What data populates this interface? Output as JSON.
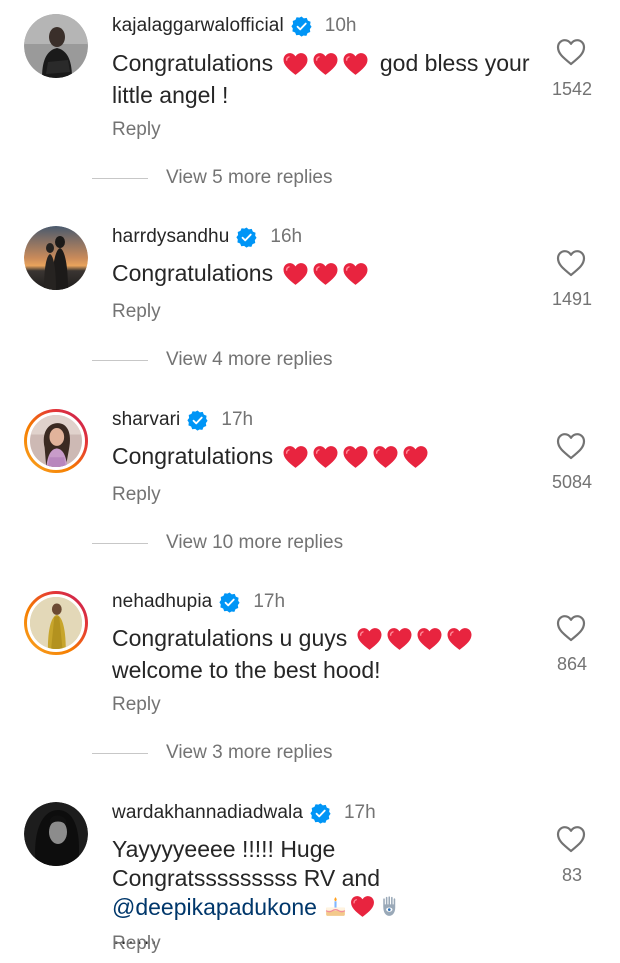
{
  "comments": [
    {
      "username": "kajalaggarwalofficial",
      "time": "10h",
      "text_a": "Congratulations",
      "text_b": "god bless your little angel !",
      "likes": "1542",
      "reply_label": "Reply",
      "view_replies": "View 5 more replies"
    },
    {
      "username": "harrdysandhu",
      "time": "16h",
      "text_a": "Congratulations",
      "likes": "1491",
      "reply_label": "Reply",
      "view_replies": "View 4 more replies"
    },
    {
      "username": "sharvari",
      "time": "17h",
      "text_a": "Congratulations",
      "likes": "5084",
      "reply_label": "Reply",
      "view_replies": "View 10 more replies"
    },
    {
      "username": "nehadhupia",
      "time": "17h",
      "text_a": "Congratulations u guys",
      "text_b": "welcome to the best hood!",
      "likes": "864",
      "reply_label": "Reply",
      "view_replies": "View 3 more replies"
    },
    {
      "username": "wardakhannadiadwala",
      "time": "17h",
      "text_a": "Yayyyyeeee !!!!! Huge Congratsssssssss RV and",
      "mention": "@deepikapadukone",
      "text_b": "……",
      "likes": "83",
      "reply_label": "Reply"
    }
  ],
  "icons": {
    "verified": "verified-badge-icon",
    "like": "heart-outline-icon",
    "heart_emoji": "red-heart-emoji",
    "cake_emoji": "birthday-cake-emoji",
    "hamsa_emoji": "hamsa-emoji"
  },
  "colors": {
    "verified_blue": "#0095f6",
    "heart_red": "#e8243f",
    "secondary_text": "#737373",
    "primary_text": "#262626",
    "mention": "#00376b"
  }
}
